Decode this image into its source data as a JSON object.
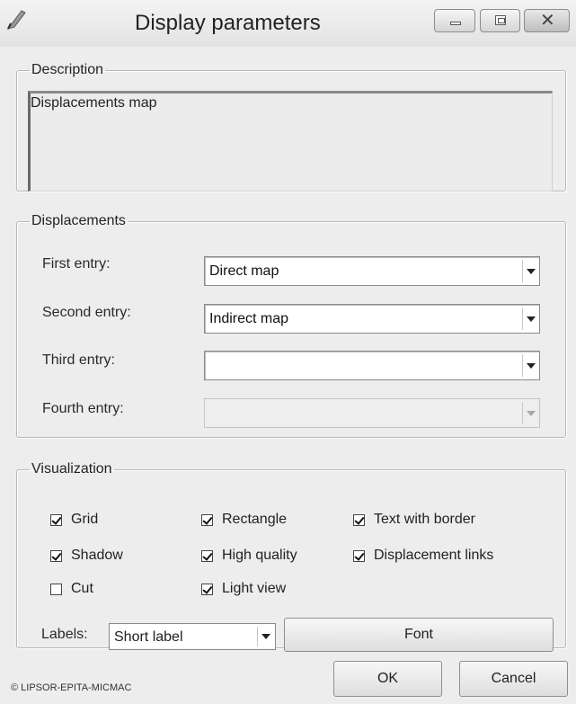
{
  "window": {
    "title": "Display parameters",
    "icon": "feather-quill-icon",
    "controls": [
      "minimize-icon",
      "maximize-icon",
      "close-icon"
    ]
  },
  "description": {
    "legend": "Description",
    "text": "Displacements map"
  },
  "displacements": {
    "legend": "Displacements",
    "entries": [
      {
        "label": "First entry:",
        "value": "Direct map",
        "enabled": true
      },
      {
        "label": "Second entry:",
        "value": "Indirect map",
        "enabled": true
      },
      {
        "label": "Third entry:",
        "value": "",
        "enabled": true
      },
      {
        "label": "Fourth entry:",
        "value": "",
        "enabled": false
      }
    ]
  },
  "visualization": {
    "legend": "Visualization",
    "checkboxes": [
      {
        "label": "Grid",
        "checked": true
      },
      {
        "label": "Rectangle",
        "checked": true
      },
      {
        "label": "Text with border",
        "checked": true
      },
      {
        "label": "Shadow",
        "checked": true
      },
      {
        "label": "High quality",
        "checked": true
      },
      {
        "label": "Displacement links",
        "checked": true
      },
      {
        "label": "Cut",
        "checked": false
      },
      {
        "label": "Light view",
        "checked": true
      }
    ],
    "labels_caption": "Labels:",
    "labels_value": "Short label",
    "font_button": "Font"
  },
  "footer": {
    "copyright": "© LIPSOR-EPITA-MICMAC",
    "ok": "OK",
    "cancel": "Cancel"
  }
}
